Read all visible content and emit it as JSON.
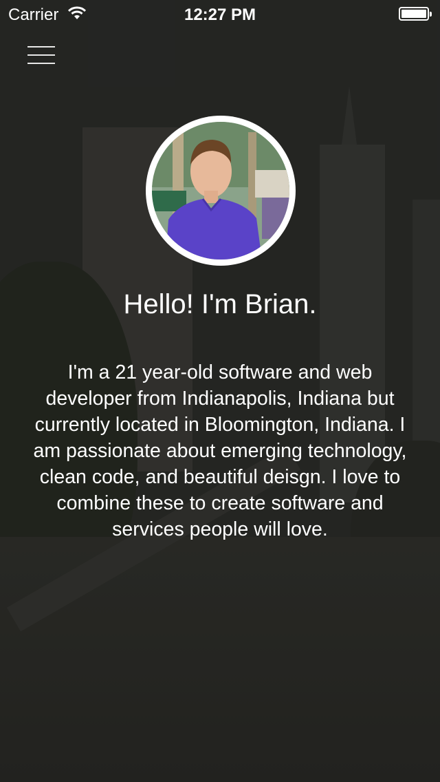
{
  "status_bar": {
    "carrier": "Carrier",
    "time": "12:27 PM",
    "battery_level": 1.0,
    "icons": [
      "wifi-icon",
      "battery-icon"
    ]
  },
  "nav": {
    "menu_icon": "hamburger-menu-icon"
  },
  "profile": {
    "greeting": "Hello! I'm Brian.",
    "bio": "I'm a 21 year-old software and web developer from Indianapolis, Indiana but currently located in Bloomington, Indiana. I am passionate about emerging technology, clean code, and beautiful deisgn. I love to combine these to create software and services people will love."
  },
  "colors": {
    "text": "#ffffff",
    "overlay": "#2d2e2c",
    "avatar_border": "#ffffff",
    "shirt": "#5a43c8"
  }
}
